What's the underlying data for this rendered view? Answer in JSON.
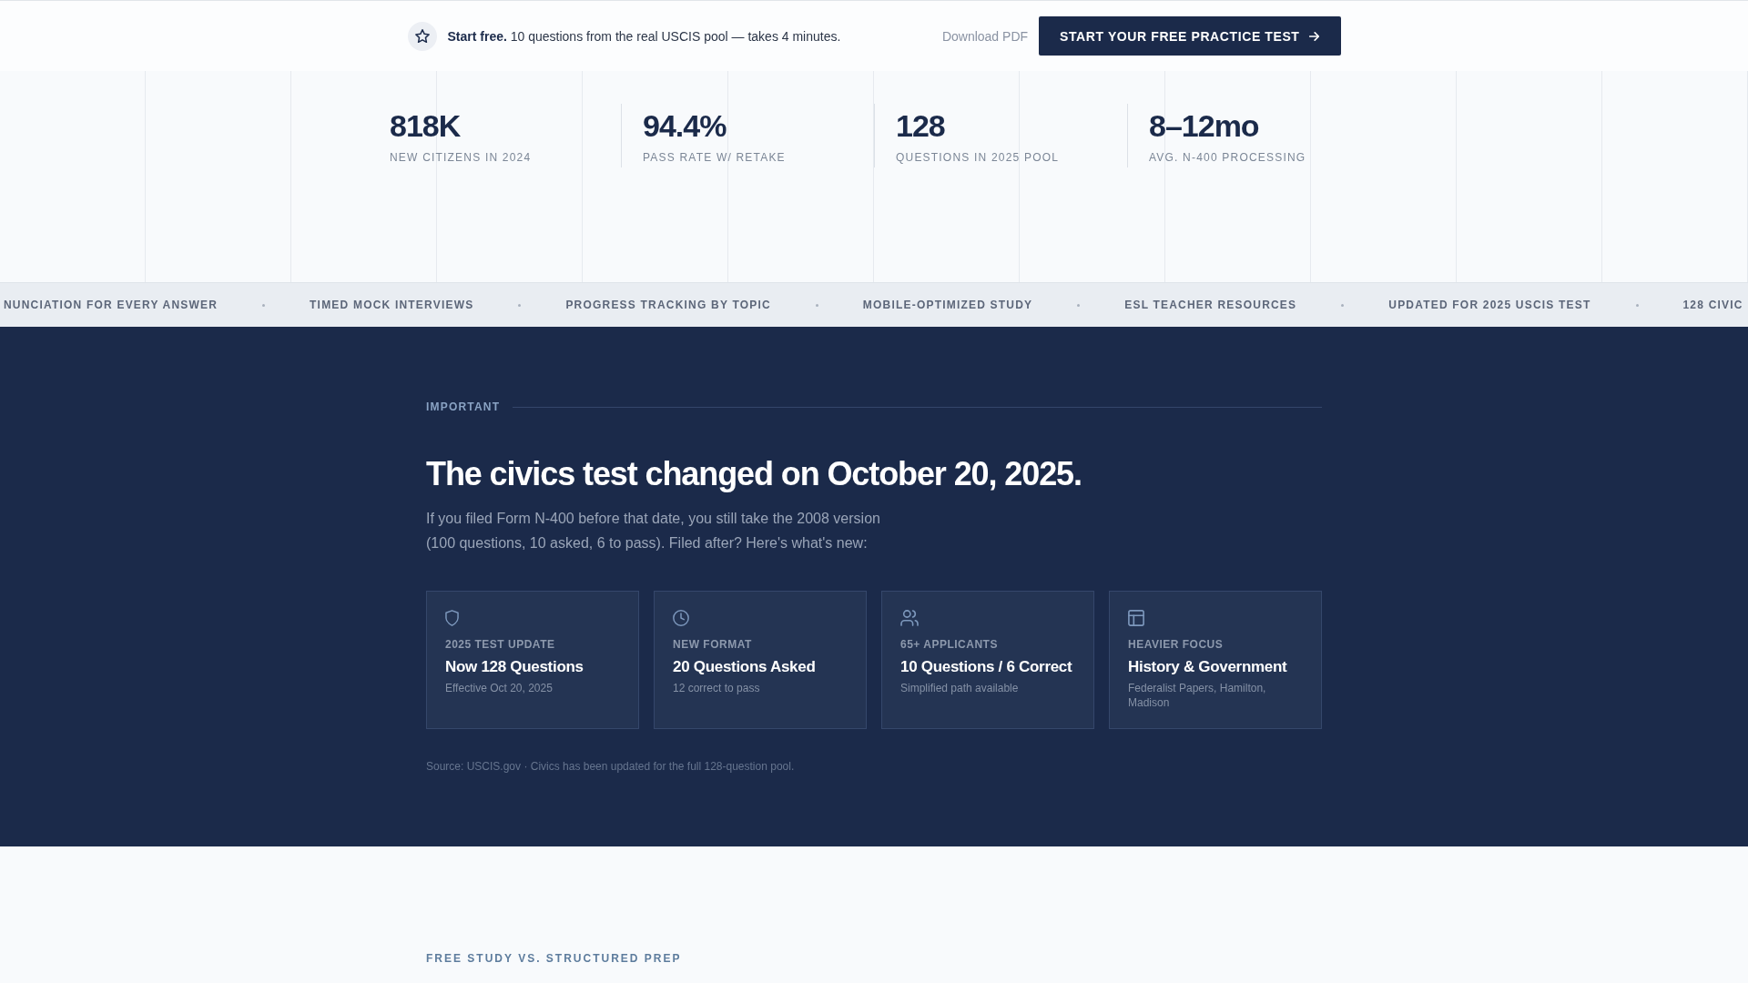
{
  "top_bar": {
    "lead": "**Start free.** 10 questions from the real USCIS pool — takes 4 minutes.",
    "link": "Download PDF",
    "button": "START YOUR FREE PRACTICE TEST"
  },
  "stats": [
    {
      "value": "818K",
      "label": "NEW CITIZENS IN 2024"
    },
    {
      "value": "94.4%",
      "label": "PASS RATE W/ RETAKE"
    },
    {
      "value": "128",
      "label": "QUESTIONS IN 2025 POOL"
    },
    {
      "value": "8–12mo",
      "label": "AVG. N-400 PROCESSING"
    }
  ],
  "ticker": [
    "NUNCIATION FOR EVERY ANSWER",
    "TIMED MOCK INTERVIEWS",
    "PROGRESS TRACKING BY TOPIC",
    "MOBILE-OPTIMIZED STUDY",
    "ESL TEACHER RESOURCES",
    "UPDATED FOR 2025 USCIS TEST",
    "128 CIVIC"
  ],
  "notice": {
    "eyebrow": "IMPORTANT",
    "title": "The civics test changed on October 20, 2025.",
    "body": "If you filed Form N-400 before that date, you still take the 2008 version (100 questions, 10 asked, 6 to pass). Filed after? Here's what's new:",
    "cards": [
      {
        "label": "2025 TEST UPDATE",
        "title": "Now 128 Questions",
        "note": "Effective Oct 20, 2025"
      },
      {
        "label": "NEW FORMAT",
        "title": "20 Questions Asked",
        "note": "12 correct to pass"
      },
      {
        "label": "65+ APPLICANTS",
        "title": "10 Questions / 6 Correct",
        "note": "Simplified path available"
      },
      {
        "label": "HEAVIER FOCUS",
        "title": "History & Government",
        "note": "Federalist Papers, Hamilton, Madison"
      }
    ],
    "source": "Source: USCIS.gov · Civics has been updated for the full 128-question pool."
  },
  "next_section": {
    "eyebrow": "FREE STUDY VS. STRUCTURED PREP"
  }
}
